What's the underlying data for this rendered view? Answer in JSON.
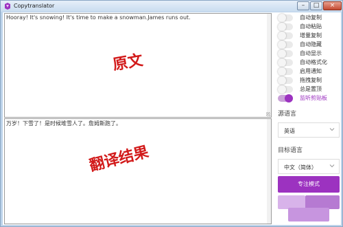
{
  "window": {
    "title": "Copytranslator",
    "minimize_glyph": "–",
    "maximize_glyph": "□",
    "close_glyph": "×"
  },
  "source": {
    "text": "Hooray! It's snowing! It's time to make a snowman.James runs out."
  },
  "target": {
    "text": "万岁！下雪了！是时候堆雪人了。詹姆斯跑了。"
  },
  "annotations": {
    "source_label": "原文",
    "target_label": "翻译结果",
    "color": "#d21a1a"
  },
  "options": [
    {
      "label": "自动复制",
      "on": false
    },
    {
      "label": "自动粘贴",
      "on": false
    },
    {
      "label": "增量复制",
      "on": false
    },
    {
      "label": "自动隐藏",
      "on": false
    },
    {
      "label": "自动显示",
      "on": false
    },
    {
      "label": "自动格式化",
      "on": false
    },
    {
      "label": "启用通知",
      "on": false
    },
    {
      "label": "拖拽复制",
      "on": false
    },
    {
      "label": "总是置顶",
      "on": false
    },
    {
      "label": "监听剪贴板",
      "on": true
    }
  ],
  "source_language": {
    "label": "源语言",
    "value": "英语"
  },
  "target_language": {
    "label": "目标语言",
    "value": "中文（简体）"
  },
  "focus_button": {
    "label": "专注模式"
  },
  "colors": {
    "accent": "#9c32c0",
    "accent_light": "#c9a1d8"
  }
}
